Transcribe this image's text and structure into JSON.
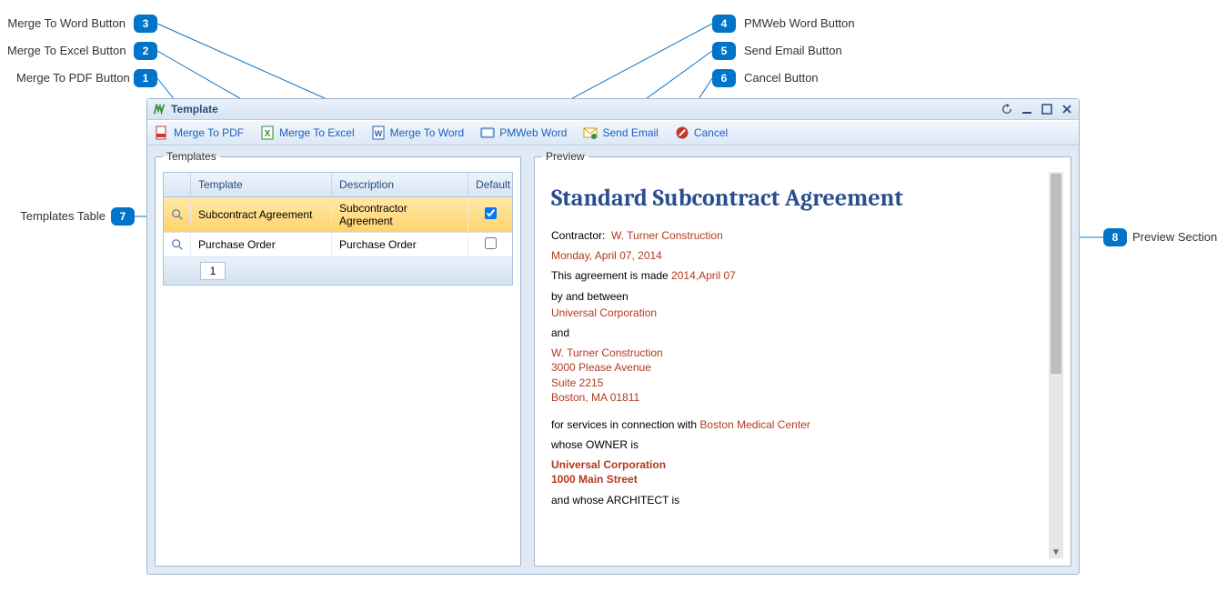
{
  "window": {
    "title": "Template"
  },
  "toolbar": {
    "merge_pdf": "Merge To PDF",
    "merge_excel": "Merge To Excel",
    "merge_word": "Merge To Word",
    "pmweb_word": "PMWeb Word",
    "send_email": "Send Email",
    "cancel": "Cancel"
  },
  "panels": {
    "templates_legend": "Templates",
    "preview_legend": "Preview"
  },
  "table": {
    "headers": {
      "template": "Template",
      "description": "Description",
      "default": "Default"
    },
    "rows": [
      {
        "template": "Subcontract Agreement",
        "description": "Subcontractor Agreement",
        "default": true
      },
      {
        "template": "Purchase Order",
        "description": "Purchase Order",
        "default": false
      }
    ],
    "page": "1"
  },
  "preview": {
    "title": "Standard Subcontract Agreement",
    "contractor_label": "Contractor:",
    "contractor_value": "W. Turner Construction",
    "date": "Monday, April 07, 2014",
    "agreement_prefix": "This agreement is made",
    "agreement_date": "2014,April 07",
    "by_and_between": "by and between",
    "party_a": "Universal Corporation",
    "and": "and",
    "party_b_name": "W. Turner Construction",
    "party_b_addr1": "3000 Please Avenue",
    "party_b_addr2": "Suite 2215",
    "party_b_addr3": "Boston,  MA   01811",
    "services_prefix": "for services in connection with",
    "services_value": "Boston Medical Center",
    "owner_label": "whose OWNER is",
    "owner_name": "Universal Corporation",
    "owner_addr": "1000 Main Street",
    "architect_label": "and whose ARCHITECT is"
  },
  "callouts": {
    "l1": "Merge To PDF Button",
    "l2": "Merge To Excel Button",
    "l3": "Merge To Word Button",
    "l4": "PMWeb Word Button",
    "l5": "Send Email Button",
    "l6": "Cancel Button",
    "l7": "Templates Table",
    "l8": "Preview Section"
  }
}
